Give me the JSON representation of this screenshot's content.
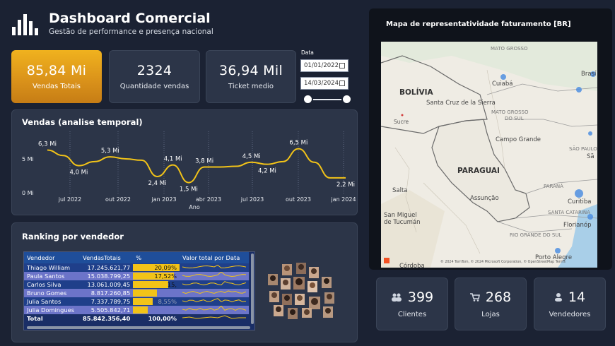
{
  "header": {
    "title": "Dashboard Comercial",
    "subtitle": "Gestão de performance e presença nacional"
  },
  "kpis": [
    {
      "value": "85,84 Mi",
      "label": "Vendas Totais"
    },
    {
      "value": "2324",
      "label": "Quantidade vendas"
    },
    {
      "value": "36,94 Mil",
      "label": "Ticket medio"
    }
  ],
  "date_filter": {
    "label": "Data",
    "start": "01/01/2022",
    "end": "14/03/2024"
  },
  "sales_chart": {
    "title": "Vendas (analise temporal)"
  },
  "chart_data": {
    "type": "line",
    "xlabel": "Ano",
    "ylabel": "",
    "y_ticks": [
      "0 Mi",
      "5 Mi"
    ],
    "x_ticks": [
      "jul 2022",
      "out 2022",
      "jan 2023",
      "abr 2023",
      "jul 2023",
      "out 2023",
      "jan 2024"
    ],
    "ylim": [
      0,
      7.5
    ],
    "color": "#f2c318",
    "points": [
      {
        "x": 0,
        "y": 6.3,
        "label": "6,3 Mi"
      },
      {
        "x": 1,
        "y": 5.5,
        "label": ""
      },
      {
        "x": 2,
        "y": 4.0,
        "label": "4,0 Mi"
      },
      {
        "x": 3,
        "y": 4.6,
        "label": ""
      },
      {
        "x": 4,
        "y": 5.3,
        "label": "5,3 Mi"
      },
      {
        "x": 5,
        "y": 5.0,
        "label": ""
      },
      {
        "x": 6,
        "y": 4.8,
        "label": ""
      },
      {
        "x": 7,
        "y": 2.4,
        "label": "2,4 Mi"
      },
      {
        "x": 8,
        "y": 4.1,
        "label": "4,1 Mi"
      },
      {
        "x": 9,
        "y": 1.5,
        "label": "1,5 Mi"
      },
      {
        "x": 10,
        "y": 3.8,
        "label": "3,8 Mi"
      },
      {
        "x": 11,
        "y": 3.8,
        "label": ""
      },
      {
        "x": 12,
        "y": 3.9,
        "label": ""
      },
      {
        "x": 13,
        "y": 4.5,
        "label": "4,5 Mi"
      },
      {
        "x": 14,
        "y": 4.2,
        "label": "4,2 Mi"
      },
      {
        "x": 15,
        "y": 4.6,
        "label": ""
      },
      {
        "x": 16,
        "y": 6.5,
        "label": "6,5 Mi"
      },
      {
        "x": 17,
        "y": 4.5,
        "label": ""
      },
      {
        "x": 18,
        "y": 2.2,
        "label": ""
      },
      {
        "x": 19,
        "y": 2.2,
        "label": "2,2 Mi"
      }
    ]
  },
  "ranking": {
    "title": "Ranking por vendedor",
    "columns": [
      "Vendedor",
      "VendasTotais",
      "%",
      "Valor total por Data"
    ],
    "rows": [
      {
        "name": "Thiago William",
        "total": "17.245.621,77",
        "pct": "20,09%",
        "pct_value": 20.09
      },
      {
        "name": "Paula Santos",
        "total": "15.038.799,25",
        "pct": "17,52%",
        "pct_value": 17.52
      },
      {
        "name": "Carlos Silva",
        "total": "13.061.009,45",
        "pct": "15,",
        "pct_value": 15.22
      },
      {
        "name": "Bruno Gomes",
        "total": "8.817.260,85",
        "pct": "",
        "pct_value": 10.27
      },
      {
        "name": "Julia Santos",
        "total": "7.337.789,75",
        "pct": "8,55%",
        "pct_value": 8.55
      },
      {
        "name": "Julia Domingues",
        "total": "5.505.842,71",
        "pct": "",
        "pct_value": 6.41
      }
    ],
    "total_row": {
      "name": "Total",
      "total": "85.842.356,40",
      "pct": "100,00%"
    }
  },
  "map": {
    "title": "Mapa de representatividade faturamento [BR]",
    "labels": {
      "mato_grosso": "MATO GROSSO",
      "bolivia": "BOLÍVIA",
      "cuiaba": "Cuiabá",
      "brasilia": "Brasí",
      "santa_cruz": "Santa Cruz de la Sierra",
      "mato_grosso_sul": "MATO GROSSO\nDO SUL",
      "sucre": "Sucre",
      "campo_grande": "Campo Grande",
      "sao_paulo": "SÃO PAULO",
      "sao_paulo_city": "Sã",
      "paraguai": "PARAGUAI",
      "parana": "PARANÁ",
      "salta": "Salta",
      "assuncao": "Assunção",
      "curitiba": "Curitiba",
      "santa_catarina": "SANTA CATARINA",
      "florianopolis": "Florianóp",
      "sm_tucuman": "San Miguel\nde Tucumán",
      "rio_grande": "RIO GRANDE DO SUL",
      "porto_alegre": "Porto Alegre",
      "cordoba": "Córdoba",
      "copyright": "© 2024 TomTom, © 2024 Microsoft Corporation, © OpenStreetMap  Terms"
    }
  },
  "bottom_kpis": [
    {
      "value": "399",
      "label": "Clientes",
      "icon": "people-icon"
    },
    {
      "value": "268",
      "label": "Lojas",
      "icon": "cart-icon"
    },
    {
      "value": "14",
      "label": "Vendedores",
      "icon": "person-icon"
    }
  ]
}
